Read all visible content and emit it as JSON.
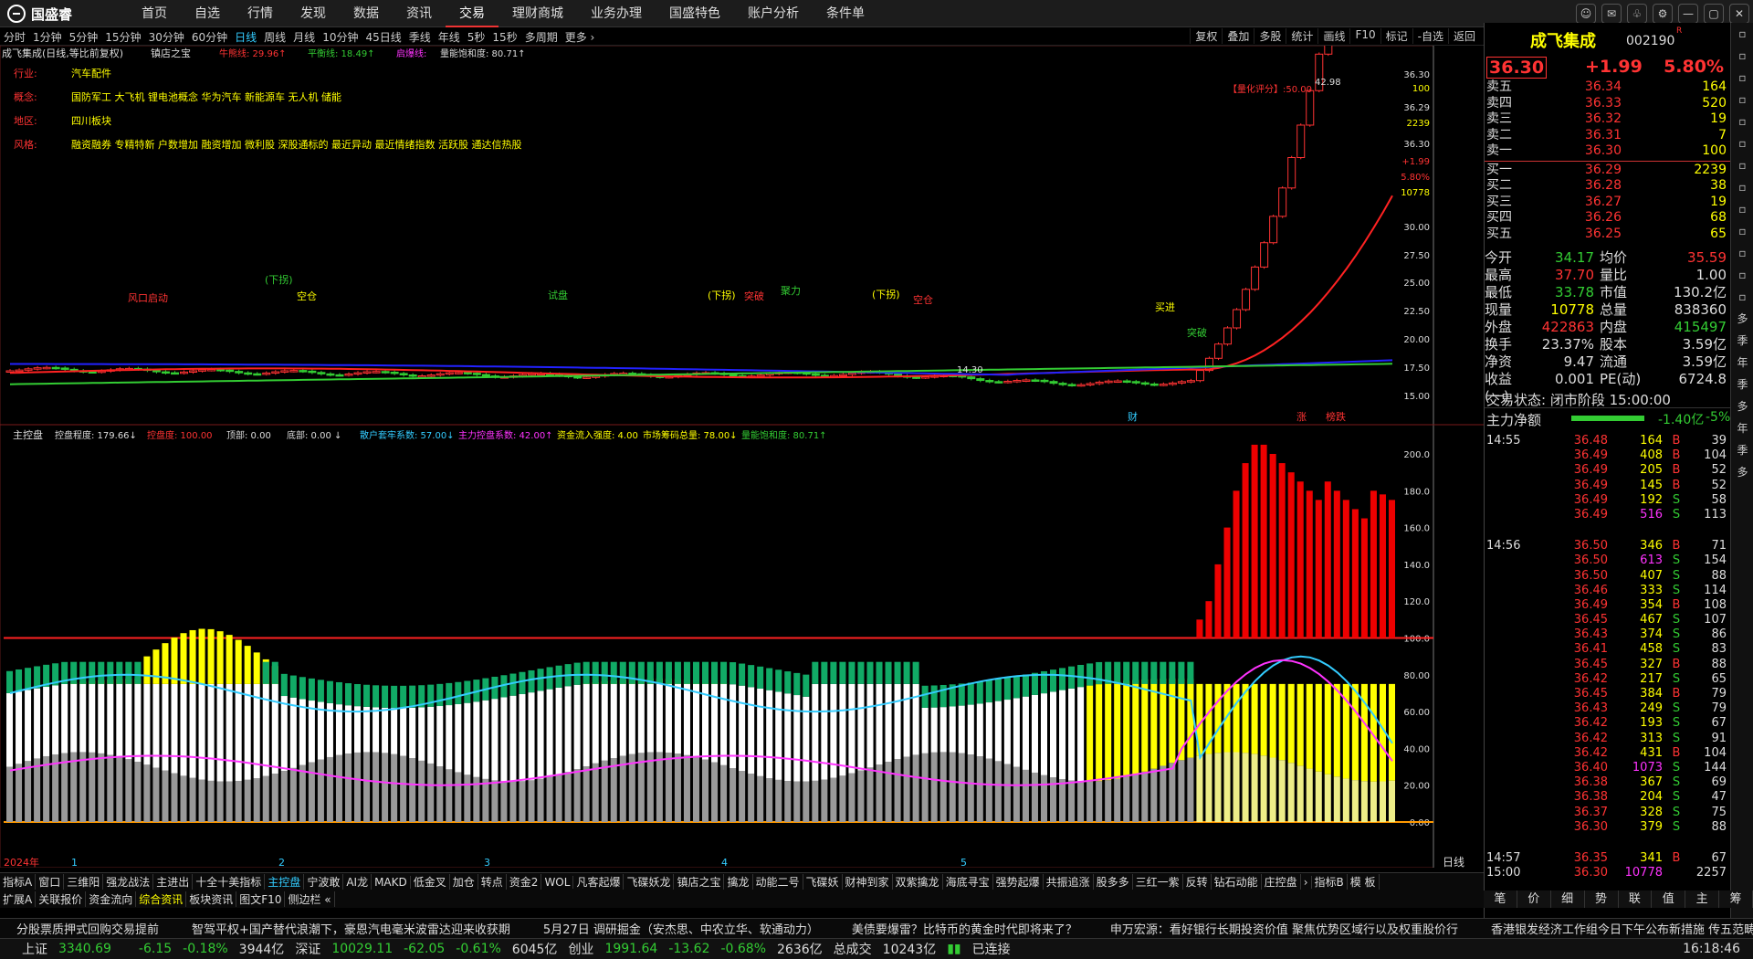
{
  "app": {
    "logo_text": "国盛睿"
  },
  "nav": [
    "首页",
    "自选",
    "行情",
    "发现",
    "数据",
    "资讯",
    "交易",
    "理财商城",
    "业务办理",
    "国盛特色",
    "账户分析",
    "条件单"
  ],
  "nav_active": 6,
  "window_controls": [
    "chat-icon",
    "message-icon",
    "skin-icon",
    "settings-icon",
    "minimize-icon",
    "restore-icon",
    "close-icon"
  ],
  "periods": [
    "分时",
    "1分钟",
    "5分钟",
    "15分钟",
    "30分钟",
    "60分钟",
    "日线",
    "周线",
    "月线",
    "10分钟",
    "45日线",
    "季线",
    "年线",
    "5秒",
    "15秒",
    "多周期",
    "更多 ›"
  ],
  "period_active": 6,
  "tools": [
    "复权",
    "叠加",
    "多股",
    "统计",
    "画线",
    "F10",
    "标记",
    "-自选",
    "返回"
  ],
  "chart": {
    "header": "成飞集成(日线,等比前复权)",
    "indicator_name": "镇店之宝",
    "ind_items": [
      {
        "text": "牛熊线: 29.96↑",
        "color": "#f33"
      },
      {
        "text": "平衡线: 18.49↑",
        "color": "#3c3"
      },
      {
        "text": "启爆线:",
        "color": "#f3f"
      },
      {
        "text": "量能饱和度: 80.71↑",
        "color": "#ddd"
      }
    ],
    "info": [
      {
        "label": "行业:",
        "value": "汽车配件"
      },
      {
        "label": "概念:",
        "value": "国防军工 大飞机 锂电池概念 华为汽车 新能源车 无人机 储能"
      },
      {
        "label": "地区:",
        "value": "四川板块"
      },
      {
        "label": "风格:",
        "value": "融资融券 专精特新 户数增加 融资增加 微利股 深股通标的 最近异动 最近情绪指数 活跃股 通达信热股"
      }
    ],
    "rating": "【量化评分】:50.00",
    "price_axis": [
      "36.30",
      "100",
      "36.29",
      "2239",
      "36.30",
      "+1.99",
      "5.80%",
      "10778",
      "30.00",
      "27.50",
      "25.00",
      "22.50",
      "20.00",
      "17.50",
      "15.00"
    ],
    "peak_label": "42.98",
    "low_label": "14.30",
    "markers": [
      "财",
      "涨",
      "榜跌"
    ],
    "annotations": [
      "(下拐)",
      "空仓",
      "风口启动",
      "试盘",
      "(下拐)",
      "突破",
      "聚力",
      "(下拐)",
      "空仓",
      "突破",
      "买进"
    ],
    "lower_header": "主控盘",
    "lower_items": [
      {
        "text": "控盘程度: 179.66↓",
        "color": "#ddd"
      },
      {
        "text": "控盘度: 100.00",
        "color": "#f33"
      },
      {
        "text": "顶部: 0.00",
        "color": "#ddd"
      },
      {
        "text": "底部: 0.00 ↓",
        "color": "#ddd"
      },
      {
        "text": "散户套牢系数: 57.00↓",
        "color": "#3cf"
      },
      {
        "text": "主力控盘系数: 42.00↑",
        "color": "#f3f"
      },
      {
        "text": "资金流入强度: 4.00",
        "color": "#ff0"
      },
      {
        "text": "市场筹码总量: 78.00↓",
        "color": "#ff0"
      },
      {
        "text": "量能饱和度: 80.71↑",
        "color": "#3c3"
      }
    ],
    "lower_axis": [
      "200.0",
      "180.0",
      "160.0",
      "140.0",
      "120.0",
      "100.0",
      "80.00",
      "60.00",
      "40.00",
      "20.00",
      "0.00"
    ],
    "date_labels": [
      "2024年",
      "1",
      "2",
      "3",
      "4",
      "5"
    ],
    "period_label": "日线"
  },
  "bottom_tabs1": [
    "指标A",
    "窗口",
    "三维阳",
    "强龙战法",
    "主进出",
    "十全十美指标",
    "主控盘",
    "宁波敢",
    "AI龙",
    "MAKD",
    "低金叉",
    "加仓",
    "转点",
    "资金2",
    "WOL",
    "凡客起爆",
    "飞碟妖龙",
    "镇店之宝",
    "擒龙",
    "动能二号",
    "飞碟妖",
    "财神到家",
    "双紫擒龙",
    "海底寻宝",
    "强势起爆",
    "共振追涨",
    "股多多",
    "三红一紫",
    "反转",
    "钻石动能",
    "庄控盘",
    "›",
    "指标B",
    "模 板"
  ],
  "bottom_tabs1_active": 6,
  "bottom_tabs2": [
    "扩展A",
    "关联报价",
    "资金流向",
    "综合资讯",
    "板块资讯",
    "图文F10",
    "侧边栏 «"
  ],
  "bottom_tabs2_active": 3,
  "right": {
    "name": "成飞集成",
    "code": "002190",
    "badge": "R",
    "price": "36.30",
    "change": "+1.99",
    "pct": "5.80%",
    "asks": [
      [
        "卖五",
        "36.34",
        "164"
      ],
      [
        "卖四",
        "36.33",
        "520"
      ],
      [
        "卖三",
        "36.32",
        "19"
      ],
      [
        "卖二",
        "36.31",
        "7"
      ],
      [
        "卖一",
        "36.30",
        "100"
      ]
    ],
    "bids": [
      [
        "买一",
        "36.29",
        "2239"
      ],
      [
        "买二",
        "36.28",
        "38"
      ],
      [
        "买三",
        "36.27",
        "19"
      ],
      [
        "买四",
        "36.26",
        "68"
      ],
      [
        "买五",
        "36.25",
        "65"
      ]
    ],
    "stats": [
      [
        "今开",
        "34.17",
        "均价",
        "35.59",
        "#3c3",
        "#f33"
      ],
      [
        "最高",
        "37.70",
        "量比",
        "1.00",
        "#f33",
        "#ddd"
      ],
      [
        "最低",
        "33.78",
        "市值",
        "130.2亿",
        "#3c3",
        "#ddd"
      ],
      [
        "现量",
        "10778",
        "总量",
        "838360",
        "#ff0",
        "#ddd"
      ],
      [
        "外盘",
        "422863",
        "内盘",
        "415497",
        "#f33",
        "#3c3"
      ],
      [
        "换手",
        "23.37%",
        "股本",
        "3.59亿",
        "#ddd",
        "#ddd"
      ],
      [
        "净资",
        "9.47",
        "流通",
        "3.59亿",
        "#ddd",
        "#ddd"
      ],
      [
        "收益(一)",
        "0.001",
        "PE(动)",
        "6724.8",
        "#ddd",
        "#ddd"
      ]
    ],
    "trade_status": "交易状态: 闭市阶段 15:00:00",
    "main_net_label": "主力净额",
    "main_net_value": "-1.40亿",
    "main_net_pct": "-5%",
    "ticks": [
      [
        "14:55",
        "36.48",
        "164",
        "B",
        "39"
      ],
      [
        "",
        "36.49",
        "408",
        "B",
        "104"
      ],
      [
        "",
        "36.49",
        "205",
        "B",
        "52"
      ],
      [
        "",
        "36.49",
        "145",
        "B",
        "52"
      ],
      [
        "",
        "36.49",
        "192",
        "S",
        "58"
      ],
      [
        "",
        "36.49",
        "516",
        "S",
        "113"
      ],
      [
        "14:56",
        "36.50",
        "346",
        "B",
        "71"
      ],
      [
        "",
        "36.50",
        "613",
        "S",
        "154"
      ],
      [
        "",
        "36.50",
        "407",
        "S",
        "88"
      ],
      [
        "",
        "36.46",
        "333",
        "S",
        "114"
      ],
      [
        "",
        "36.49",
        "354",
        "B",
        "108"
      ],
      [
        "",
        "36.45",
        "467",
        "S",
        "107"
      ],
      [
        "",
        "36.43",
        "374",
        "S",
        "86"
      ],
      [
        "",
        "36.41",
        "458",
        "S",
        "83"
      ],
      [
        "",
        "36.45",
        "327",
        "B",
        "88"
      ],
      [
        "",
        "36.42",
        "217",
        "S",
        "65"
      ],
      [
        "",
        "36.45",
        "384",
        "B",
        "79"
      ],
      [
        "",
        "36.43",
        "249",
        "S",
        "79"
      ],
      [
        "",
        "36.42",
        "193",
        "S",
        "67"
      ],
      [
        "",
        "36.42",
        "313",
        "S",
        "91"
      ],
      [
        "",
        "36.42",
        "431",
        "B",
        "104"
      ],
      [
        "",
        "36.40",
        "1073",
        "S",
        "144"
      ],
      [
        "",
        "36.38",
        "367",
        "S",
        "69"
      ],
      [
        "",
        "36.38",
        "204",
        "S",
        "47"
      ],
      [
        "",
        "36.37",
        "328",
        "S",
        "75"
      ],
      [
        "",
        "36.30",
        "379",
        "S",
        "88"
      ],
      [
        "14:57",
        "36.35",
        "341",
        "B",
        "67"
      ],
      [
        "15:00",
        "36.30",
        "10778",
        "",
        "2257"
      ]
    ],
    "tabs": [
      "笔",
      "价",
      "细",
      "势",
      "联",
      "值",
      "主",
      "筹"
    ]
  },
  "sidebar": [
    "多",
    "季",
    "年",
    "季",
    "多",
    "年",
    "季",
    "多"
  ],
  "news": [
    "分股票质押式回购交易提前",
    "智驾平权+国产替代浪潮下，豪恩汽电毫米波雷达迎来收获期",
    "5月27日 调研掘金（安杰思、中农立华、软通动力）",
    "美债要爆雷？比特币的黄金时代即将来了？",
    "申万宏源：看好银行长期投资价值 聚焦优势区域行以及权重股价行",
    "香港银发经济工作组今日下午公布新措施 传五范畴出击促进“银色消"
  ],
  "status": {
    "sh_label": "上证",
    "sh": "3340.69",
    "sh_chg": "-6.15",
    "sh_pct": "-0.18%",
    "sh_amt": "3944亿",
    "sz_label": "深证",
    "sz": "10029.11",
    "sz_chg": "-62.05",
    "sz_pct": "-0.61%",
    "sz_amt": "6045亿",
    "cy_label": "创业",
    "cy": "1991.64",
    "cy_chg": "-13.62",
    "cy_pct": "-0.68%",
    "cy_amt": "2636亿",
    "total_label": "总成交",
    "total": "10243亿",
    "conn": "已连接",
    "time": "16:18:46"
  },
  "colors": {
    "up": "#ff3333",
    "down": "#33cc33",
    "yellow": "#ffff00",
    "cyan": "#33ccff",
    "magenta": "#ff33ff"
  }
}
